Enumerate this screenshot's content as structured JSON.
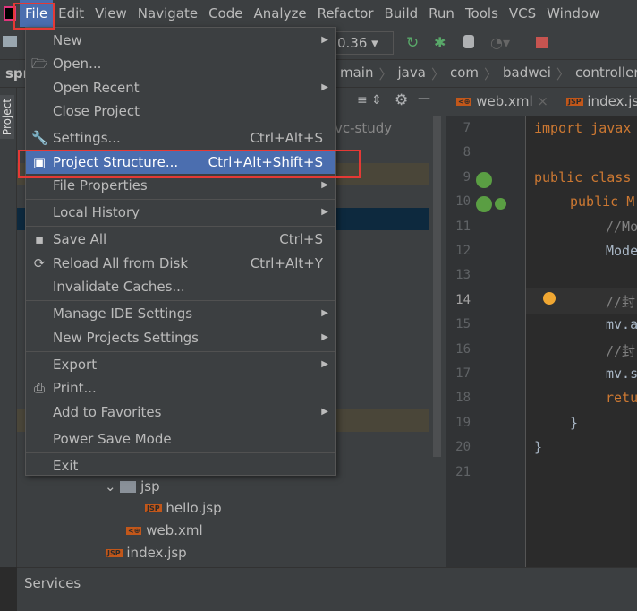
{
  "menubar": [
    "File",
    "Edit",
    "View",
    "Navigate",
    "Code",
    "Analyze",
    "Refactor",
    "Build",
    "Run",
    "Tools",
    "VCS",
    "Window"
  ],
  "toolbar": {
    "run_config": "0.36"
  },
  "breadcrumb": [
    "main",
    "java",
    "com",
    "badwei",
    "controller"
  ],
  "project_label": "Project",
  "project_short": "spr",
  "project_root": "vc-study",
  "tabs": [
    {
      "label": "web.xml"
    },
    {
      "label": "index.jsp"
    }
  ],
  "file_menu": [
    {
      "label": "New",
      "arrow": true
    },
    {
      "label": "Open...",
      "icon": "folder-icon"
    },
    {
      "label": "Open Recent",
      "arrow": true
    },
    {
      "label": "Close Project"
    },
    {
      "sep": true
    },
    {
      "label": "Settings...",
      "shortcut": "Ctrl+Alt+S",
      "icon": "wrench-icon"
    },
    {
      "label": "Project Structure...",
      "shortcut": "Ctrl+Alt+Shift+S",
      "selected": true,
      "icon": "project-structure-icon"
    },
    {
      "label": "File Properties",
      "arrow": true
    },
    {
      "sep": true
    },
    {
      "label": "Local History",
      "arrow": true
    },
    {
      "sep": true
    },
    {
      "label": "Save All",
      "shortcut": "Ctrl+S",
      "icon": "save-icon"
    },
    {
      "label": "Reload All from Disk",
      "shortcut": "Ctrl+Alt+Y",
      "icon": "reload-icon"
    },
    {
      "label": "Invalidate Caches..."
    },
    {
      "sep": true
    },
    {
      "label": "Manage IDE Settings",
      "arrow": true
    },
    {
      "label": "New Projects Settings",
      "arrow": true
    },
    {
      "sep": true
    },
    {
      "label": "Export",
      "arrow": true
    },
    {
      "label": "Print...",
      "icon": "print-icon"
    },
    {
      "label": "Add to Favorites",
      "arrow": true
    },
    {
      "sep": true
    },
    {
      "label": "Power Save Mode"
    },
    {
      "sep": true
    },
    {
      "label": "Exit"
    }
  ],
  "tree": {
    "jsp_folder": "jsp",
    "hello": "hello.jsp",
    "webxml": "web.xml",
    "index": "index.jsp"
  },
  "code": {
    "lines": [
      "7",
      "8",
      "9",
      "10",
      "11",
      "12",
      "13",
      "14",
      "15",
      "16",
      "17",
      "18",
      "19",
      "20",
      "21"
    ],
    "l7": "import javax",
    "l9": "public class",
    "l10": "public M",
    "l11": "//Mo",
    "l12": "Mode",
    "l14": "//封",
    "l15": "mv.a",
    "l16": "//封",
    "l17": "mv.s",
    "l18": "retu",
    "l19": "}",
    "l20": "}"
  },
  "services": "Services"
}
